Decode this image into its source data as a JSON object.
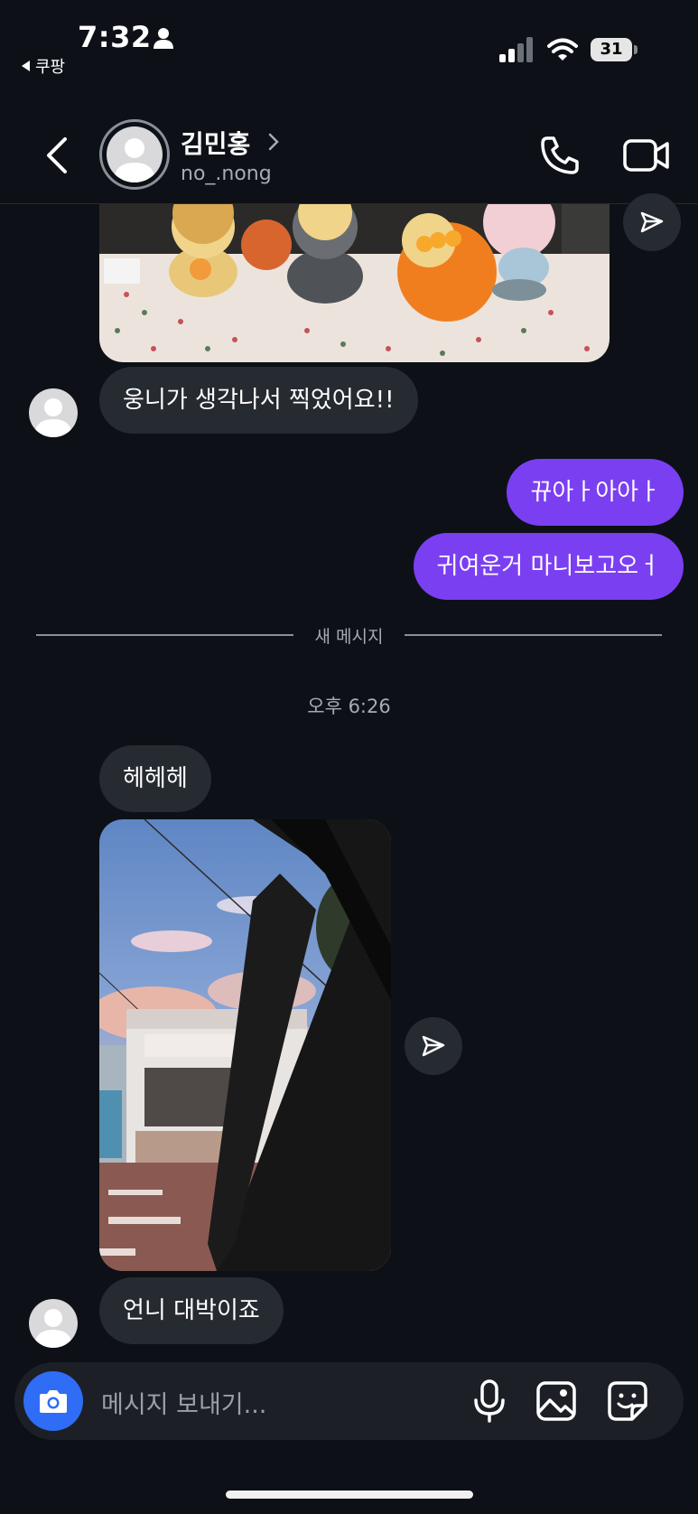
{
  "status_bar": {
    "time": "7:32",
    "back_app": "쿠팡",
    "battery": "31"
  },
  "header": {
    "name": "김민홍",
    "username": "no_.nong"
  },
  "messages": [
    {
      "direction": "incoming",
      "text": "웅니가 생각나서 찍었어요!!"
    },
    {
      "direction": "outgoing",
      "text": "뀨아ㅏ아아ㅏ"
    },
    {
      "direction": "outgoing",
      "text": "귀여운거 마니보고오ㅓ"
    },
    {
      "direction": "incoming",
      "text": "헤헤헤"
    },
    {
      "direction": "incoming",
      "text": "언니 대박이죠"
    }
  ],
  "divider": {
    "label": "새 메시지"
  },
  "timestamp": "오후 6:26",
  "composer": {
    "placeholder": "메시지 보내기..."
  },
  "colors": {
    "background": "#0d1117",
    "incoming_bubble": "#262a31",
    "outgoing_bubble": "#7b3ff2",
    "camera_button": "#2f6df6"
  },
  "icons": [
    "person-icon",
    "signal-icon",
    "wifi-icon",
    "back-icon",
    "chevron-right-icon",
    "phone-icon",
    "video-icon",
    "share-icon",
    "camera-icon",
    "mic-icon",
    "gallery-icon",
    "sticker-icon"
  ]
}
